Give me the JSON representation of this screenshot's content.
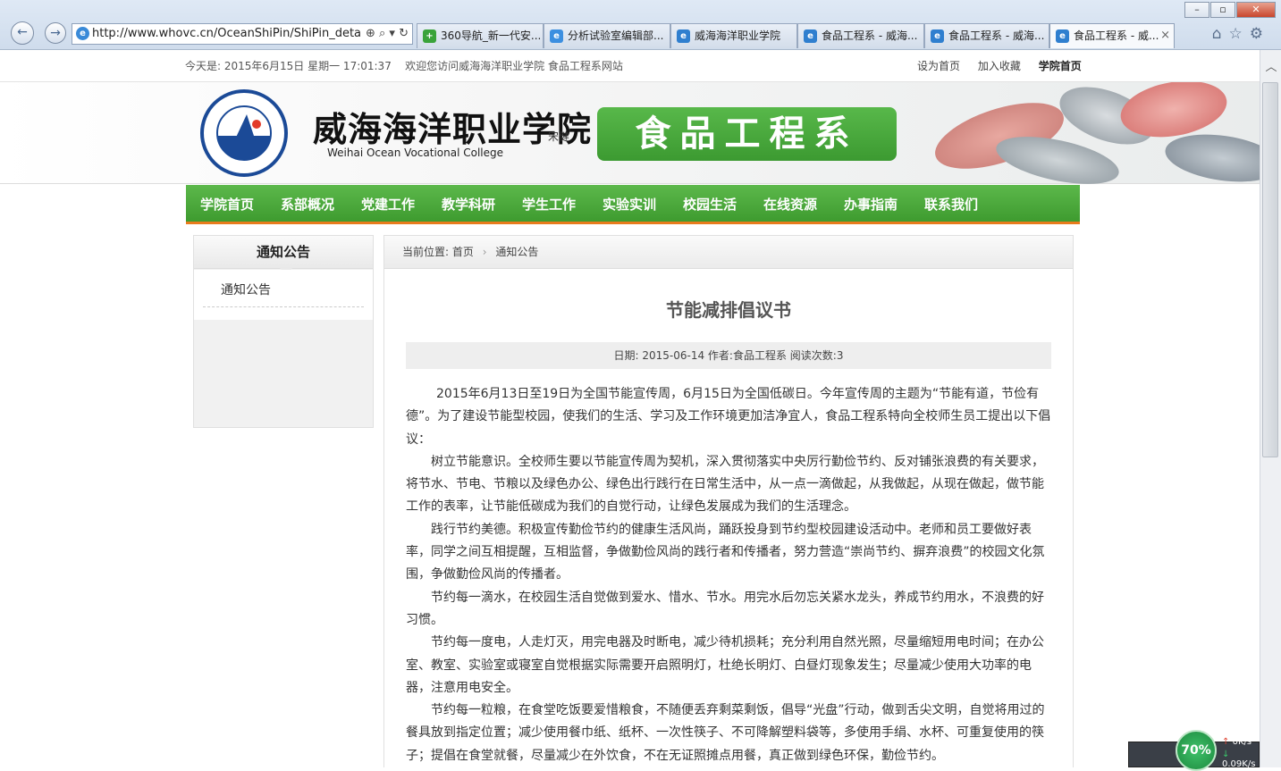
{
  "browser": {
    "url": "http://www.whovc.cn/OceanShiPin/ShiPin_details",
    "tabs": [
      {
        "label": "360导航_新一代安..."
      },
      {
        "label": "分析试验室编辑部..."
      },
      {
        "label": "威海海洋职业学院"
      },
      {
        "label": "食品工程系 - 威海..."
      },
      {
        "label": "食品工程系 - 威海..."
      },
      {
        "label": "食品工程系 - 威..."
      }
    ]
  },
  "topbar": {
    "date_text": "今天是: 2015年6月15日 星期一  17:01:37",
    "welcome": "欢迎您访问威海海洋职业学院 食品工程系网站",
    "links": [
      "设为首页",
      "加入收藏",
      "学院首页"
    ]
  },
  "banner": {
    "college_cn": "威海海洋职业学院",
    "college_en": "Weihai Ocean Vocational College",
    "signature": "宋健",
    "department": "食品工程系"
  },
  "nav": {
    "items": [
      "学院首页",
      "系部概况",
      "党建工作",
      "教学科研",
      "学生工作",
      "实验实训",
      "校园生活",
      "在线资源",
      "办事指南",
      "联系我们"
    ]
  },
  "sidebar": {
    "title": "通知公告",
    "items": [
      "通知公告"
    ]
  },
  "breadcrumb": {
    "prefix": "当前位置:",
    "home": "首页",
    "current": "通知公告"
  },
  "article": {
    "title": "节能减排倡议书",
    "meta": "日期: 2015-06-14 作者:食品工程系 阅读次数:3",
    "paragraphs": [
      "2015年6月13日至19日为全国节能宣传周，6月15日为全国低碳日。今年宣传周的主题为“节能有道，节俭有德”。为了建设节能型校园，使我们的生活、学习及工作环境更加洁净宜人，食品工程系特向全校师生员工提出以下倡议：",
      "树立节能意识。全校师生要以节能宣传周为契机，深入贯彻落实中央厉行勤俭节约、反对铺张浪费的有关要求，将节水、节电、节粮以及绿色办公、绿色出行践行在日常生活中，从一点一滴做起，从我做起，从现在做起，做节能工作的表率，让节能低碳成为我们的自觉行动，让绿色发展成为我们的生活理念。",
      "践行节约美德。积极宣传勤俭节约的健康生活风尚，踊跃投身到节约型校园建设活动中。老师和员工要做好表率，同学之间互相提醒，互相监督，争做勤俭风尚的践行者和传播者，努力营造“崇尚节约、摒弃浪费”的校园文化氛围，争做勤俭风尚的传播者。",
      "节约每一滴水，在校园生活自觉做到爱水、惜水、节水。用完水后勿忘关紧水龙头，养成节约用水，不浪费的好习惯。",
      "节约每一度电，人走灯灭，用完电器及时断电，减少待机损耗；充分利用自然光照，尽量缩短用电时间；在办公室、教室、实验室或寝室自觉根据实际需要开启照明灯，杜绝长明灯、白昼灯现象发生；尽量减少使用大功率的电器，注意用电安全。",
      "节约每一粒粮，在食堂吃饭要爱惜粮食，不随便丢弃剩菜剩饭，倡导“光盘”行动，做到舌尖文明，自觉将用过的餐具放到指定位置；减少使用餐巾纸、纸杯、一次性筷子、不可降解塑料袋等，多使用手绢、水杯、可重复使用的筷子；提倡在食堂就餐，尽量减少在外饮食，不在无证照摊点用餐，真正做到绿色环保，勤俭节约。"
    ]
  },
  "network": {
    "percent": "70%",
    "upload": "0K/s",
    "download": "0.09K/s"
  }
}
